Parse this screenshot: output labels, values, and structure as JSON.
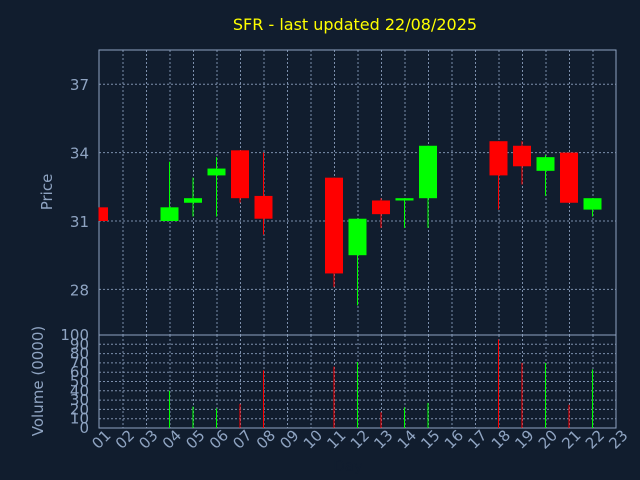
{
  "chart_data": {
    "type": "candlestick",
    "title": "SFR - last updated 22/08/2025",
    "price_panel": {
      "ylabel": "Price",
      "ylim": [
        26,
        38.5
      ],
      "y_ticks": [
        28,
        31,
        34,
        37
      ]
    },
    "volume_panel": {
      "ylabel": "Volume (0000)",
      "ylim": [
        0,
        100
      ],
      "y_ticks": [
        0,
        10,
        20,
        30,
        40,
        50,
        60,
        70,
        80,
        90,
        100
      ]
    },
    "xlabel": "Day",
    "x_ticks": [
      "01",
      "02",
      "03",
      "04",
      "05",
      "06",
      "07",
      "08",
      "09",
      "10",
      "11",
      "12",
      "13",
      "14",
      "15",
      "16",
      "17",
      "18",
      "19",
      "20",
      "21",
      "22",
      "23"
    ],
    "colors": {
      "up": "#00ff00",
      "down": "#ff0000"
    },
    "candles": [
      {
        "day": "01",
        "open": 31.6,
        "high": 31.6,
        "low": 31.0,
        "close": 31.0,
        "volume": 0
      },
      {
        "day": "04",
        "open": 31.0,
        "high": 33.6,
        "low": 31.0,
        "close": 31.6,
        "volume": 40
      },
      {
        "day": "05",
        "open": 31.8,
        "high": 32.9,
        "low": 31.2,
        "close": 32.0,
        "volume": 23
      },
      {
        "day": "06",
        "open": 33.0,
        "high": 33.8,
        "low": 31.2,
        "close": 33.3,
        "volume": 21
      },
      {
        "day": "07",
        "open": 34.1,
        "high": 34.1,
        "low": 31.8,
        "close": 32.0,
        "volume": 26
      },
      {
        "day": "08",
        "open": 32.1,
        "high": 34.0,
        "low": 30.4,
        "close": 31.1,
        "volume": 62
      },
      {
        "day": "11",
        "open": 32.9,
        "high": 32.9,
        "low": 28.1,
        "close": 28.7,
        "volume": 66
      },
      {
        "day": "12",
        "open": 29.5,
        "high": 31.1,
        "low": 27.3,
        "close": 31.1,
        "volume": 71
      },
      {
        "day": "13",
        "open": 31.9,
        "high": 32.0,
        "low": 30.7,
        "close": 31.3,
        "volume": 17
      },
      {
        "day": "14",
        "open": 31.9,
        "high": 32.0,
        "low": 30.7,
        "close": 32.0,
        "volume": 22
      },
      {
        "day": "15",
        "open": 32.0,
        "high": 34.3,
        "low": 30.7,
        "close": 34.3,
        "volume": 27
      },
      {
        "day": "18",
        "open": 34.5,
        "high": 34.5,
        "low": 31.5,
        "close": 33.0,
        "volume": 95
      },
      {
        "day": "19",
        "open": 34.3,
        "high": 34.5,
        "low": 32.6,
        "close": 33.4,
        "volume": 70
      },
      {
        "day": "20",
        "open": 33.2,
        "high": 33.9,
        "low": 32.1,
        "close": 33.8,
        "volume": 70
      },
      {
        "day": "21",
        "open": 34.0,
        "high": 34.0,
        "low": 31.8,
        "close": 31.8,
        "volume": 25
      },
      {
        "day": "22",
        "open": 31.5,
        "high": 32.0,
        "low": 31.2,
        "close": 32.0,
        "volume": 63
      }
    ]
  }
}
